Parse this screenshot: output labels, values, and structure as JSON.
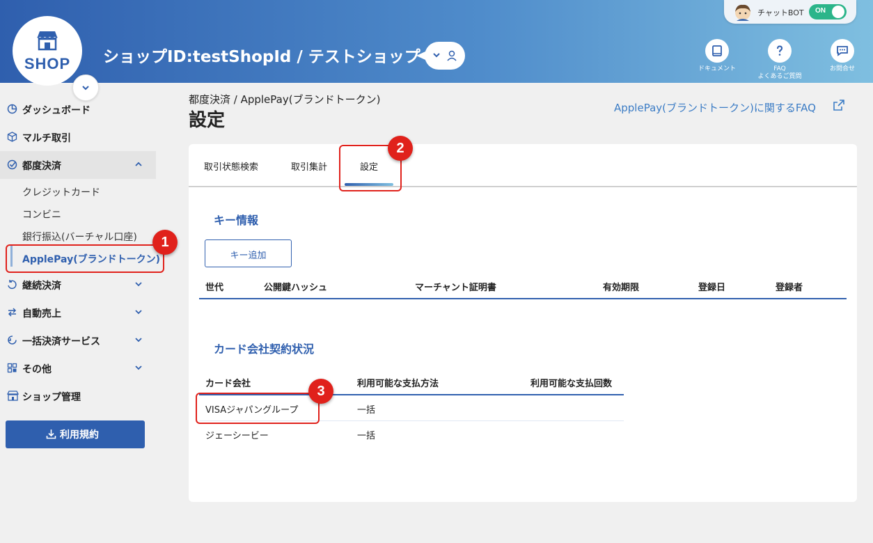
{
  "header": {
    "logo_text": "SHOP",
    "shop_title": "ショップID:testShopId / テストショップ",
    "chatbot_label": "チャットBOT",
    "chatbot_toggle": "ON",
    "buttons": [
      {
        "caption": "ドキュメント",
        "icon": "book-icon"
      },
      {
        "caption": "FAQ",
        "caption2": "よくあるご質問",
        "icon": "question-icon"
      },
      {
        "caption": "お問合せ",
        "icon": "chat-icon"
      }
    ]
  },
  "sidebar": {
    "items": [
      {
        "label": "ダッシュボード",
        "icon": "dashboard-icon"
      },
      {
        "label": "マルチ取引",
        "icon": "cube-icon"
      },
      {
        "label": "都度決済",
        "icon": "check-circle-icon"
      },
      {
        "label": "継続決済",
        "icon": "recurring-icon"
      },
      {
        "label": "自動売上",
        "icon": "exchange-icon"
      },
      {
        "label": "一括決済サービス",
        "icon": "refresh-icon"
      },
      {
        "label": "その他",
        "icon": "grid-icon"
      },
      {
        "label": "ショップ管理",
        "icon": "store-icon"
      }
    ],
    "subitems": [
      "クレジットカード",
      "コンビニ",
      "銀行振込(バーチャル口座)",
      "ApplePay(ブランドトークン)"
    ],
    "terms_button": "利用規約"
  },
  "main": {
    "breadcrumb": "都度決済 / ApplePay(ブランドトークン)",
    "title": "設定",
    "faq_link": "ApplePay(ブランドトークン)に関するFAQ",
    "tabs": [
      "取引状態検索",
      "取引集計",
      "設定"
    ],
    "key_section": {
      "title": "キー情報",
      "add_button": "キー追加",
      "columns": [
        "世代",
        "公開鍵ハッシュ",
        "マーチャント証明書",
        "有効期限",
        "登録日",
        "登録者"
      ]
    },
    "card_section": {
      "title": "カード会社契約状況",
      "columns": [
        "カード会社",
        "利用可能な支払方法",
        "利用可能な支払回数"
      ],
      "rows": [
        {
          "company": "VISAジャパングループ",
          "method": "一括",
          "count": ""
        },
        {
          "company": "ジェーシービー",
          "method": "一括",
          "count": ""
        }
      ]
    }
  },
  "annotations": [
    "1",
    "2",
    "3"
  ],
  "colors": {
    "primary": "#2f5fae",
    "accent_red": "#e0211b",
    "toggle_on": "#2bb58a"
  }
}
